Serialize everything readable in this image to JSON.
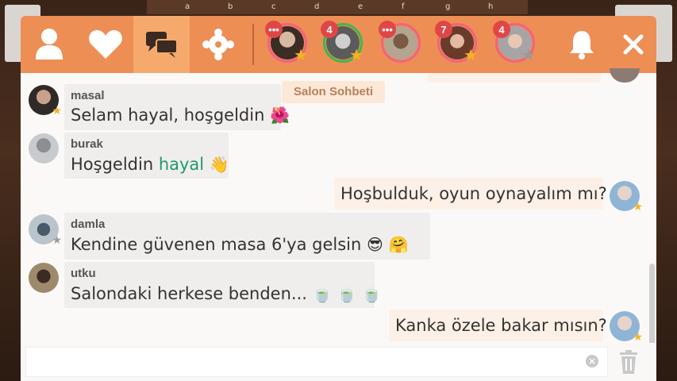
{
  "board": {
    "coords": [
      "a",
      "b",
      "c",
      "d",
      "e",
      "f",
      "g",
      "h"
    ]
  },
  "tabs": [
    {
      "name": "profile-icon"
    },
    {
      "name": "heart-icon"
    },
    {
      "name": "chat-icon",
      "active": true
    },
    {
      "name": "puzzle-icon"
    }
  ],
  "header_avatars": [
    {
      "badge": "•••",
      "ring": "#f2637f",
      "star": "gold"
    },
    {
      "badge": "4",
      "ring": "#3cb94a",
      "star": "gold"
    },
    {
      "badge": "•••",
      "ring": "#f2637f",
      "star": "none"
    },
    {
      "badge": "7",
      "ring": "#f2637f",
      "star": "gold"
    },
    {
      "badge": "4",
      "ring": "#f2637f",
      "star": "silver"
    }
  ],
  "room_label": "Salon Sohbeti",
  "messages": [
    {
      "user": "masal",
      "text": "Selam hayal, hoşgeldin",
      "emoji": "🌺",
      "mine": false
    },
    {
      "user": "burak",
      "text_before": "Hoşgeldin ",
      "mention": "hayal",
      "emoji": "👋",
      "mine": false
    },
    {
      "text": "Hoşbulduk, oyun oynayalım mı?",
      "mine": true
    },
    {
      "user": "damla",
      "text": "Kendine güvenen masa 6'ya gelsin",
      "emoji": "😎",
      "emoji2": "🤗",
      "mine": false
    },
    {
      "user": "utku",
      "text": "Salondaki herkese benden...",
      "emoji": "🍵 🍵 🍵",
      "mine": false
    },
    {
      "text": "Kanka özele bakar mısın?",
      "mine": true
    }
  ],
  "input": {
    "value": "",
    "placeholder": ""
  },
  "colors": {
    "accent": "#ed8e55",
    "active_tab": "#f6a96c",
    "mention": "#1e9b6a"
  }
}
